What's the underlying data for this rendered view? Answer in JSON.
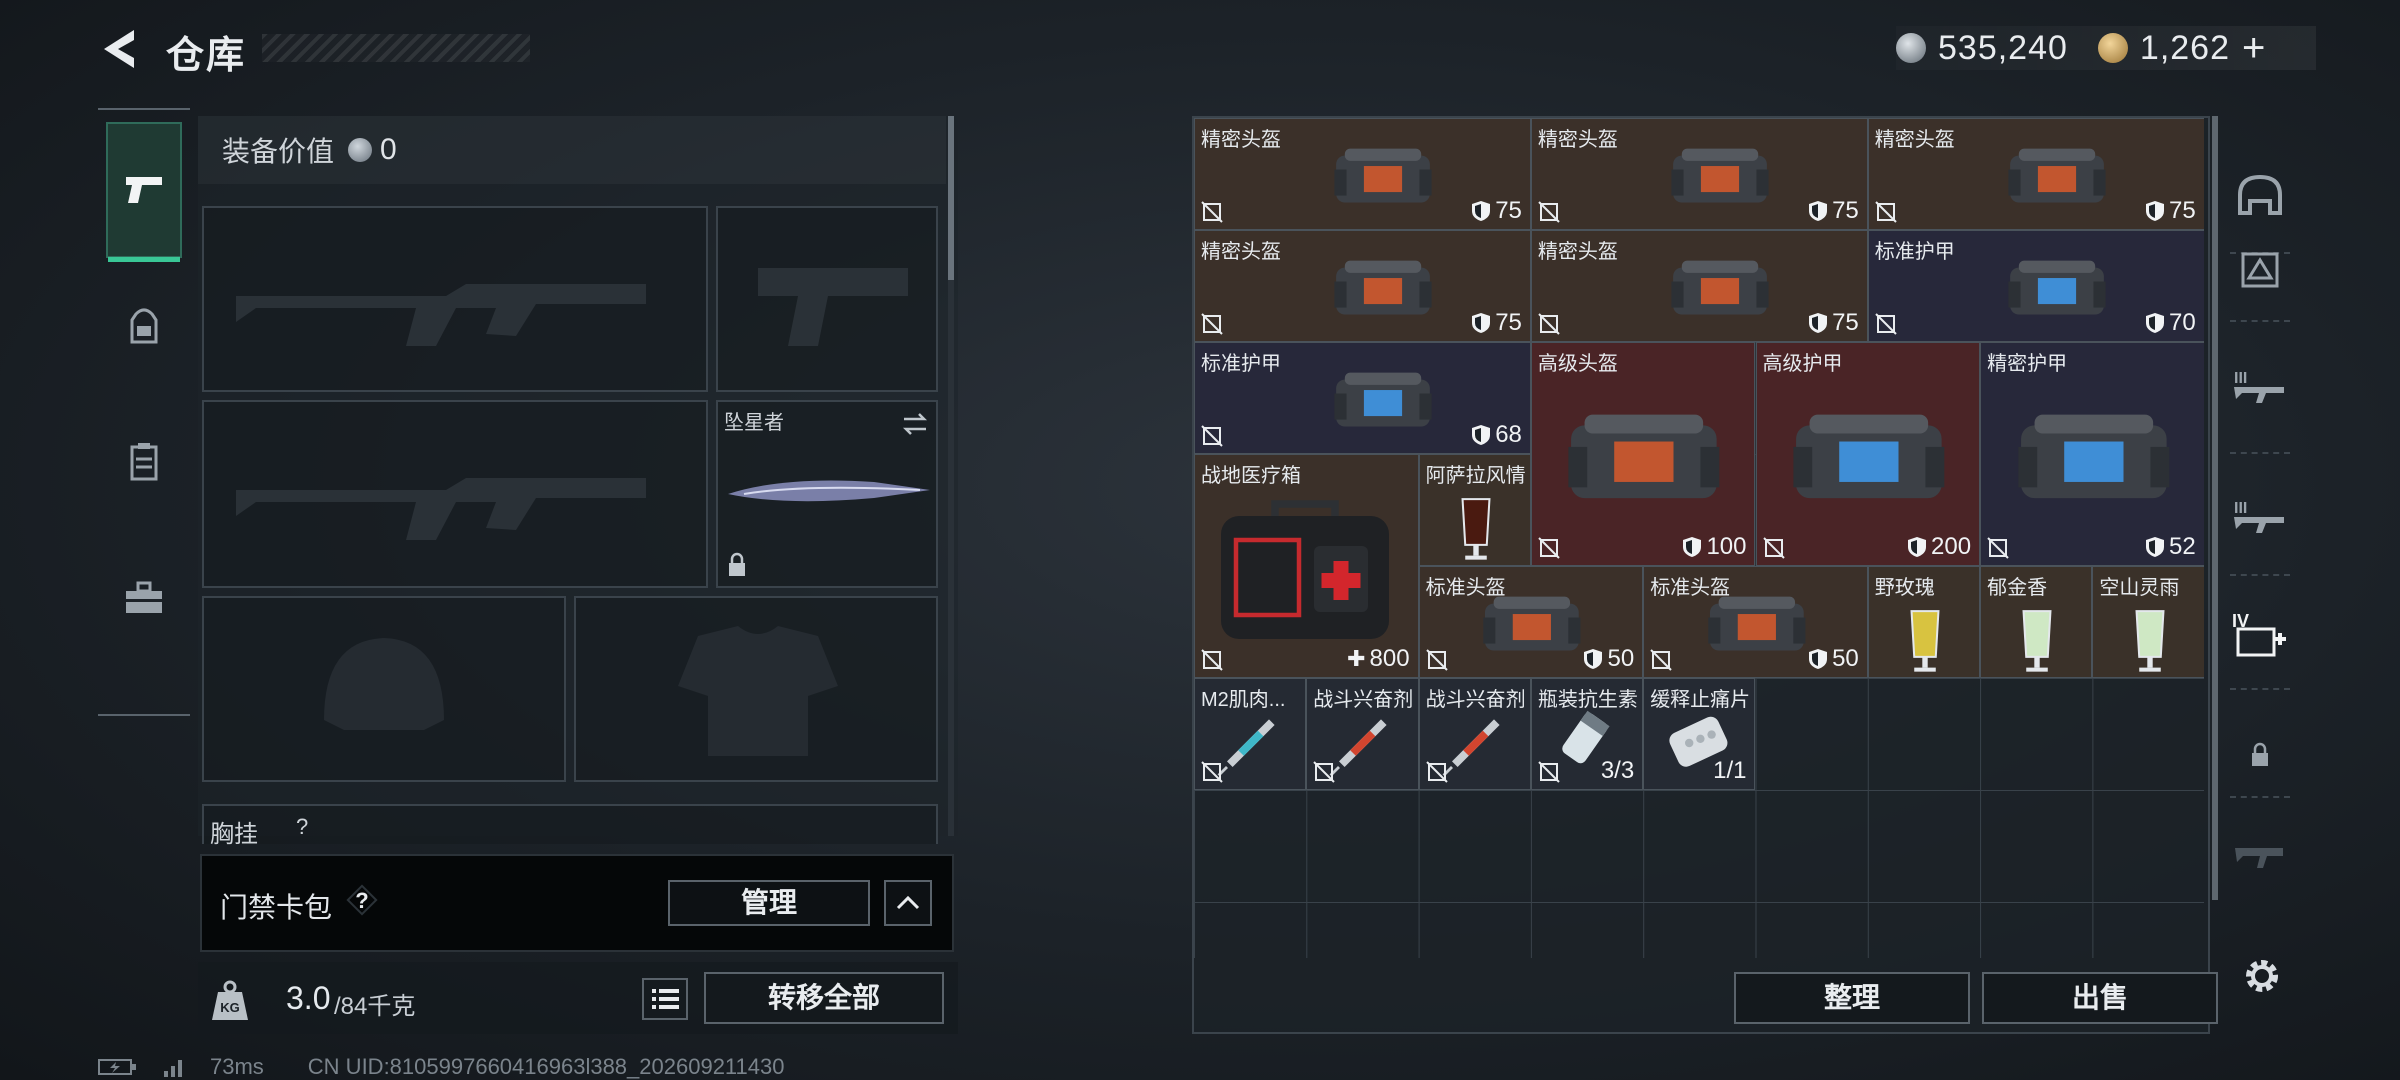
{
  "header": {
    "title": "仓库"
  },
  "currency": {
    "silver": "535,240",
    "gold": "1,262",
    "plus": "+"
  },
  "left_tabs": [
    "pistol-icon",
    "backpack-icon",
    "vest-icon",
    "toolbox-icon"
  ],
  "equipment": {
    "value_label": "装备价值",
    "value": "0",
    "melee_slot_label": "坠星者",
    "chest_rig_label": "胸挂",
    "chest_rig_help": "?"
  },
  "keycard": {
    "label": "门禁卡包",
    "help": "?",
    "manage": "管理"
  },
  "weight": {
    "current": "3.0",
    "max": "/84千克",
    "transfer_all": "转移全部"
  },
  "status": {
    "ping": "73ms",
    "uid": "CN UID:8105997660416963l388_202609211430"
  },
  "stash": {
    "items": [
      {
        "name": "精密头盔",
        "value": "75",
        "type": "helmet"
      },
      {
        "name": "精密头盔",
        "value": "75",
        "type": "helmet"
      },
      {
        "name": "精密头盔",
        "value": "75",
        "type": "helmet"
      },
      {
        "name": "精密头盔",
        "value": "75",
        "type": "helmet"
      },
      {
        "name": "精密头盔",
        "value": "75",
        "type": "helmet"
      },
      {
        "name": "标准护甲",
        "value": "70",
        "type": "armor"
      },
      {
        "name": "标准护甲",
        "value": "68",
        "type": "armor"
      },
      {
        "name": "高级头盔",
        "value": "100",
        "type": "helmet"
      },
      {
        "name": "高级护甲",
        "value": "200",
        "type": "armor"
      },
      {
        "name": "精密护甲",
        "value": "52",
        "type": "armor"
      },
      {
        "name": "战地医疗箱",
        "value": "800",
        "type": "medkit"
      },
      {
        "name": "阿萨拉风情",
        "value": "",
        "type": "drink"
      },
      {
        "name": "标准头盔",
        "value": "50",
        "type": "helmet"
      },
      {
        "name": "标准头盔",
        "value": "50",
        "type": "helmet"
      },
      {
        "name": "野玫瑰",
        "value": "",
        "type": "drink"
      },
      {
        "name": "郁金香",
        "value": "",
        "type": "drink"
      },
      {
        "name": "空山灵雨",
        "value": "",
        "type": "drink"
      },
      {
        "name": "M2肌肉...",
        "value": "",
        "type": "injector"
      },
      {
        "name": "战斗兴奋剂",
        "value": "",
        "type": "injector"
      },
      {
        "name": "战斗兴奋剂",
        "value": "",
        "type": "injector"
      },
      {
        "name": "瓶装抗生素",
        "value": "3/3",
        "type": "pills"
      },
      {
        "name": "缓释止痛片",
        "value": "1/1",
        "type": "tablets"
      }
    ],
    "tidy": "整理",
    "sell": "出售"
  },
  "right_tabs": [
    "helmet-tab-icon",
    "gear-tab-icon",
    "rifle-tab-icon",
    "smg-tab-icon",
    "medical-tab-icon",
    "locked-tab-icon",
    "locked-tab-icon-2"
  ],
  "right_tab_badges": {
    "medical": "IV"
  },
  "colors": {
    "accent": "#39c796",
    "brown_cell": "#3b3029",
    "blue_cell": "#27283a",
    "red_cell": "#4a2426"
  }
}
